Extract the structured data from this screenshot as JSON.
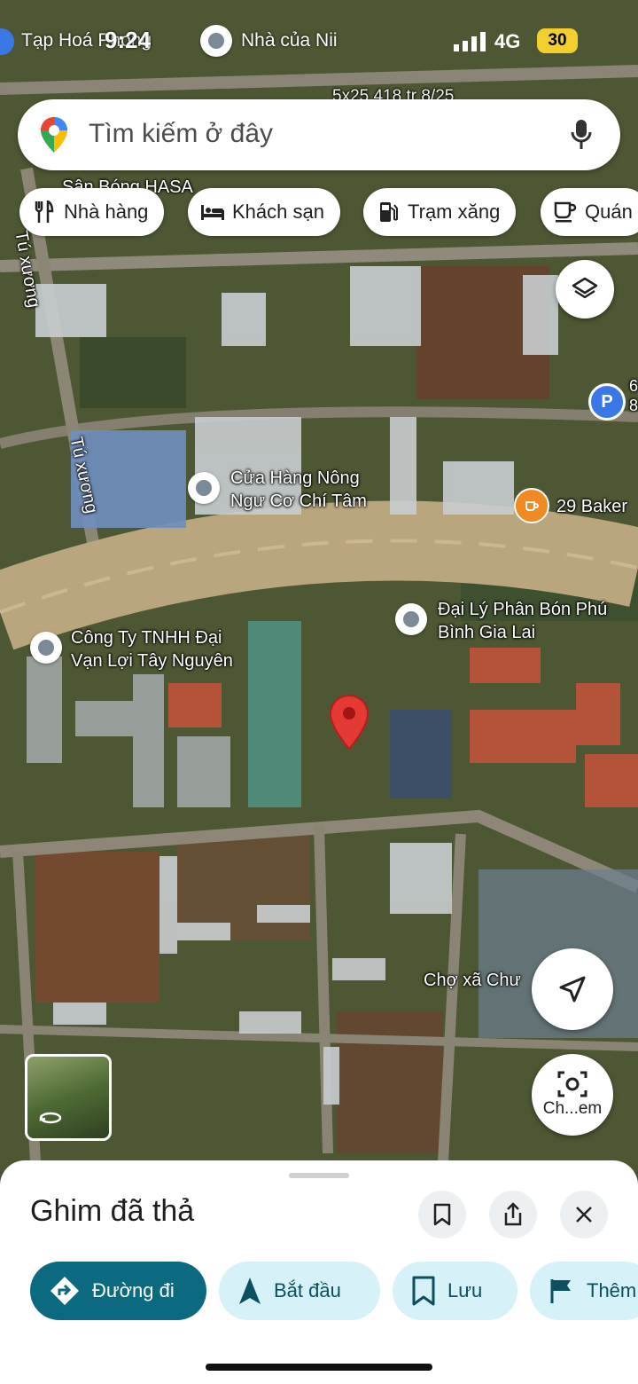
{
  "status_bar": {
    "time": "9:24",
    "network": "4G",
    "battery": "30",
    "back_app": "Tạp Hoá Phong",
    "home_label": "Nhà của Nii"
  },
  "search": {
    "placeholder": "Tìm kiếm ở đây"
  },
  "chips": [
    {
      "label": "Nhà hàng",
      "icon": "fork-knife-icon"
    },
    {
      "label": "Khách sạn",
      "icon": "bed-icon"
    },
    {
      "label": "Trạm xăng",
      "icon": "gas-pump-icon"
    },
    {
      "label": "Quán",
      "icon": "coffee-cup-icon"
    }
  ],
  "map_labels": {
    "top_partial": "5x25 418 tr 8/25",
    "stadium": "Sân Bóng HASA",
    "street_1": "Tú xương",
    "street_2": "Tú xương",
    "parking_partial": "6 8",
    "store": "Cửa Hàng Nông Ngư Cơ Chí Tâm",
    "bakery": "29 Baker",
    "company": "Công Ty TNHH Đại Vạn Lợi Tây Nguyên",
    "fertilizer": "Đại Lý Phân Bón Phú Bình Gia Lai",
    "market": "Chợ xã Chư"
  },
  "fab_camera_label": "Ch...em",
  "sheet": {
    "title": "Ghim đã thả",
    "buttons": [
      {
        "label": "Đường đi"
      },
      {
        "label": "Bắt đầu"
      },
      {
        "label": "Lưu"
      },
      {
        "label": "Thêm"
      }
    ]
  },
  "colors": {
    "primary": "#0b6a7f",
    "secondary": "#d6f1f7",
    "pin": "#e53935"
  }
}
